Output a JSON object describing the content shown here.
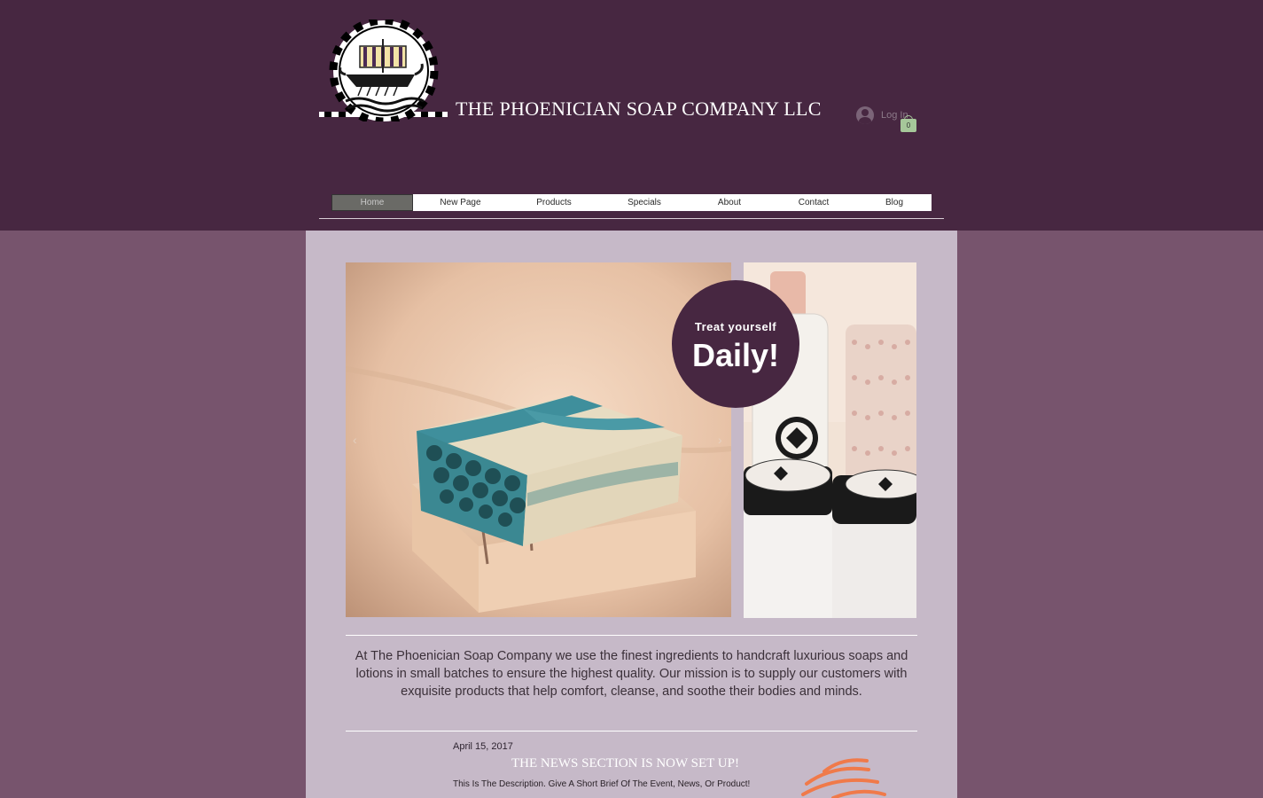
{
  "header": {
    "site_title": "THE PHOENICIAN SOAP COMPANY LLC",
    "login_label": "Log In",
    "cart_count": "0"
  },
  "nav": {
    "items": [
      {
        "label": "Home",
        "active": true
      },
      {
        "label": "New Page"
      },
      {
        "label": "Products"
      },
      {
        "label": "Specials"
      },
      {
        "label": "About"
      },
      {
        "label": "Contact"
      },
      {
        "label": "Blog"
      }
    ]
  },
  "hero": {
    "badge_small": "Treat yourself",
    "badge_big": "Daily!",
    "prev_arrow": "‹",
    "next_arrow": "›"
  },
  "mission": {
    "text": "At The Phoenician Soap Company we use the finest ingredients to handcraft luxurious soaps and lotions in small batches to ensure the highest quality. Our mission is to supply our customers with exquisite products that help comfort, cleanse, and soothe their bodies and minds."
  },
  "news": {
    "date": "April 15, 2017",
    "title": "THE NEWS SECTION IS NOW SET UP!",
    "description": "This Is The Description. Give A Short Brief Of The Event, News, Or Product!"
  },
  "colors": {
    "header_bg": "#472741",
    "page_bg": "#77546d",
    "content_bg": "#c6b9c8",
    "accent_orange": "#f07a4a"
  }
}
